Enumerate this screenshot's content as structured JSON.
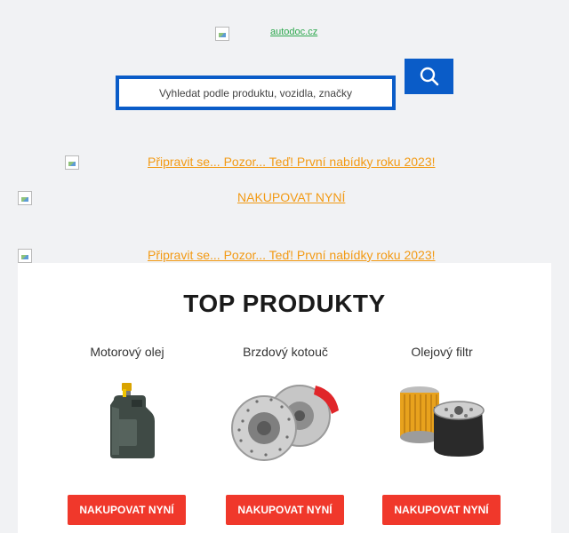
{
  "header": {
    "logo_alt": "autodoc.cz"
  },
  "search": {
    "placeholder": "Vyhledat podle produktu, vozidla, značky",
    "button_icon": "search-icon",
    "accent_color": "#0a5cc8"
  },
  "banners": [
    {
      "text": "Připravit se... Pozor... Teď! První nabídky roku 2023!"
    },
    {
      "text": "NAKUPOVAT NYNÍ"
    },
    {
      "text": "Připravit se... Pozor... Teď! První nabídky roku 2023!"
    }
  ],
  "top_products": {
    "title": "TOP PRODUKTY",
    "button_color": "#f0382b",
    "items": [
      {
        "name": "Motorový olej",
        "icon": "oil-canister-icon",
        "button_label": "NAKUPOVAT NYNÍ"
      },
      {
        "name": "Brzdový kotouč",
        "icon": "brake-disc-icon",
        "button_label": "NAKUPOVAT NYNÍ"
      },
      {
        "name": "Olejový filtr",
        "icon": "oil-filter-icon",
        "button_label": "NAKUPOVAT NYNÍ"
      }
    ]
  }
}
